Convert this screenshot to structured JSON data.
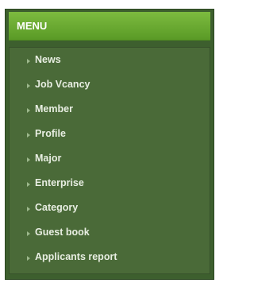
{
  "menu": {
    "title": "MENU",
    "items": [
      {
        "label": "News"
      },
      {
        "label": "Job Vcancy"
      },
      {
        "label": "Member"
      },
      {
        "label": "Profile"
      },
      {
        "label": "Major"
      },
      {
        "label": "Enterprise"
      },
      {
        "label": "Category"
      },
      {
        "label": "Guest book"
      },
      {
        "label": "Applicants report"
      }
    ]
  },
  "colors": {
    "header": "#6aab32",
    "panel": "#3d5f2e",
    "body": "#4a6a38",
    "text": "#e8eee2"
  }
}
